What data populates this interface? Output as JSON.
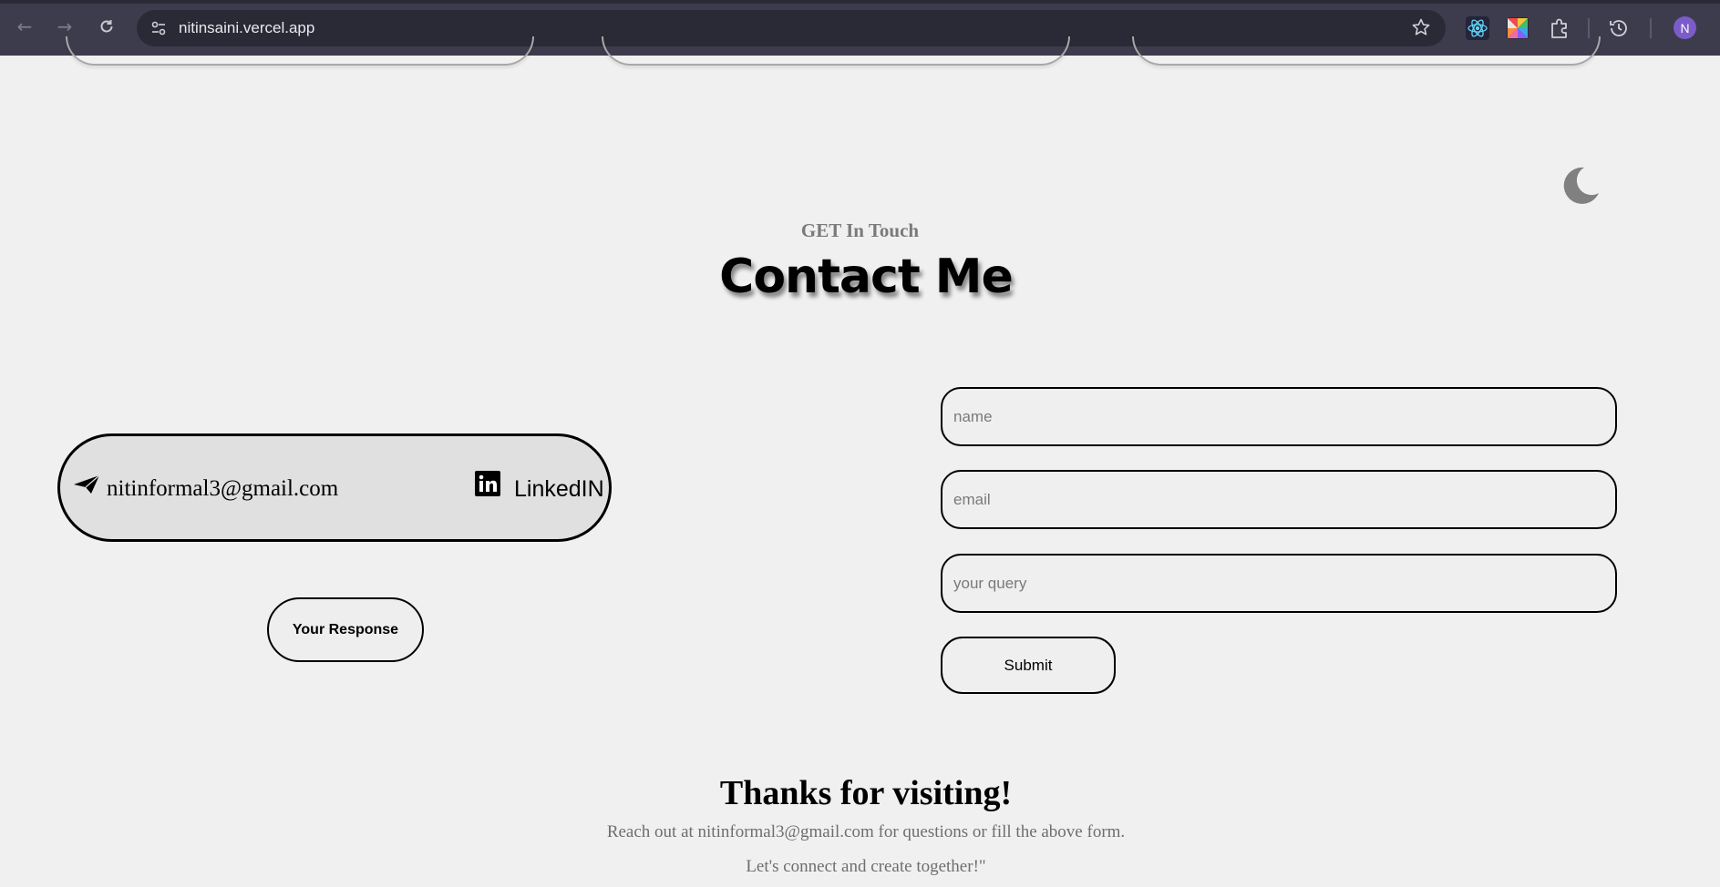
{
  "browser": {
    "url": "nitinsaini.vercel.app",
    "profile_initial": "N",
    "icons": [
      "back-icon",
      "forward-icon",
      "reload-icon",
      "site-info-icon",
      "bookmark-star-icon",
      "react-devtools-icon",
      "color-picker-extension-icon",
      "extensions-puzzle-icon",
      "history-icon"
    ]
  },
  "theme": {
    "background": "#f1f0f0",
    "chrome": "#3c3c4d",
    "avatar": "#7b5cc9",
    "pill_fill": "#e0e0e0"
  },
  "header": {
    "eyebrow": "GET In Touch",
    "title": "Contact Me"
  },
  "contact": {
    "email": "nitinformal3@gmail.com",
    "linkedin_label": "LinkedIN",
    "response_button": "Your Response"
  },
  "form": {
    "name_placeholder": "name",
    "email_placeholder": "email",
    "query_placeholder": "your query",
    "name_value": "",
    "email_value": "",
    "query_value": "",
    "submit_label": "Submit"
  },
  "footer": {
    "heading": "Thanks for visiting!",
    "line1": "Reach out at nitinformal3@gmail.com for questions or fill the above form.",
    "line2": "Let's connect and create together!\""
  }
}
